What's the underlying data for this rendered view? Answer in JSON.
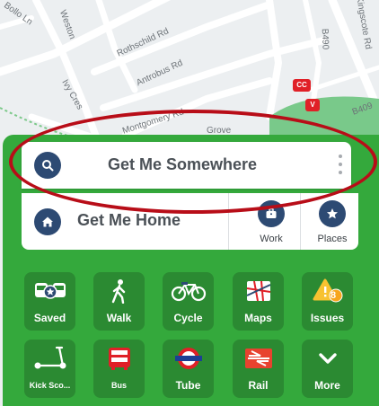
{
  "map": {
    "streets": [
      "Bollo Ln",
      "Weston",
      "Rothschild Rd",
      "Antrobus Rd",
      "Ivy Cres",
      "Montgomery Rd",
      "Grove",
      "Kingscote Rd",
      "B490",
      "B409"
    ],
    "markers": {
      "cc": "CC",
      "v": "V"
    }
  },
  "search": {
    "label": "Get Me Somewhere",
    "icon": "search-icon"
  },
  "home": {
    "label": "Get Me Home",
    "icon": "home-icon"
  },
  "quick": [
    {
      "label": "Work",
      "icon": "briefcase-icon"
    },
    {
      "label": "Places",
      "icon": "star-icon"
    }
  ],
  "tiles_row1": [
    {
      "label": "Saved",
      "icon": "saved-transport-icon"
    },
    {
      "label": "Walk",
      "icon": "walk-icon"
    },
    {
      "label": "Cycle",
      "icon": "cycle-icon"
    },
    {
      "label": "Maps",
      "icon": "maps-icon"
    },
    {
      "label": "Issues",
      "icon": "warning-icon",
      "badge": "8"
    }
  ],
  "tiles_row2": [
    {
      "label": "Kick Sco...",
      "icon": "scooter-icon"
    },
    {
      "label": "Bus",
      "icon": "bus-icon"
    },
    {
      "label": "Tube",
      "icon": "tube-icon"
    },
    {
      "label": "Rail",
      "icon": "rail-icon"
    },
    {
      "label": "More",
      "icon": "chevron-down-icon"
    }
  ],
  "colors": {
    "panel": "#34a93c",
    "tile": "#2b8a32",
    "accent": "#2d4a73",
    "highlight": "#b80d18"
  }
}
